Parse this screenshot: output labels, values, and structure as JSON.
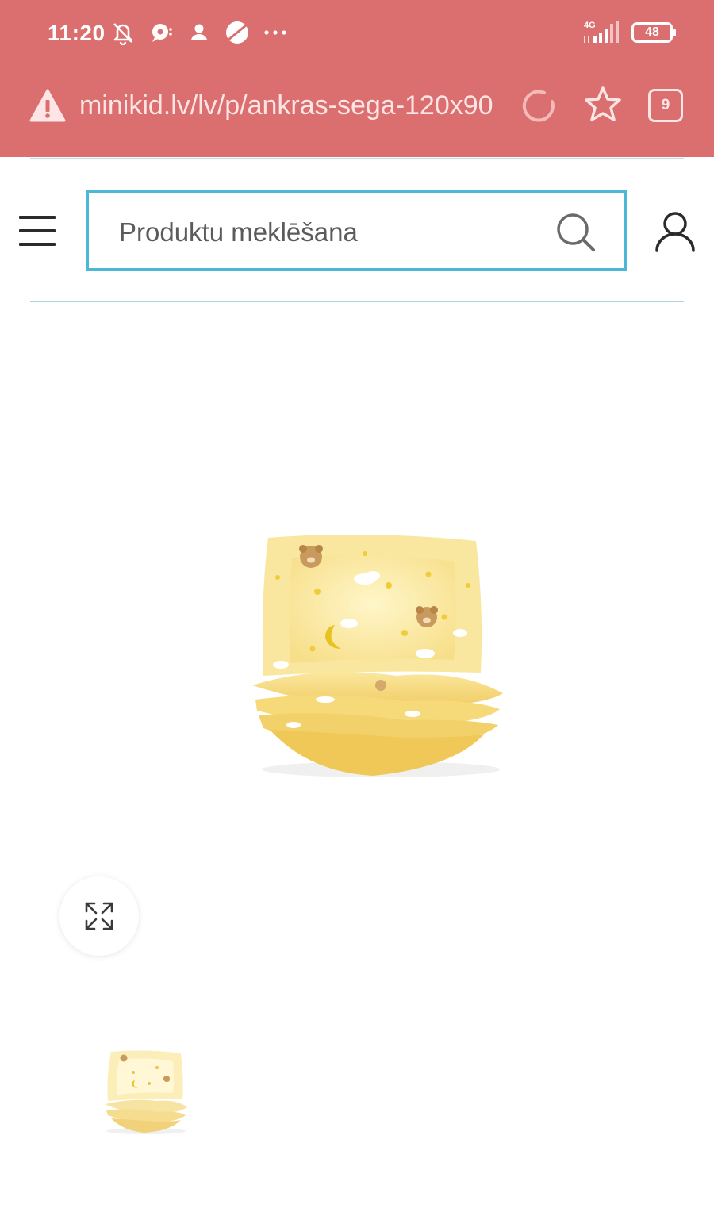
{
  "status_bar": {
    "time": "11:20",
    "network": "4G",
    "battery": "48",
    "overflow": "···"
  },
  "browser": {
    "url": "minikid.lv/lv/p/ankras-sega-120x90",
    "tab_count": "9"
  },
  "header": {
    "search_placeholder": "Produktu meklēšana"
  },
  "colors": {
    "chrome": "#db6e6e",
    "search_border": "#4eb7d6",
    "rule": "#a9d4e2"
  }
}
